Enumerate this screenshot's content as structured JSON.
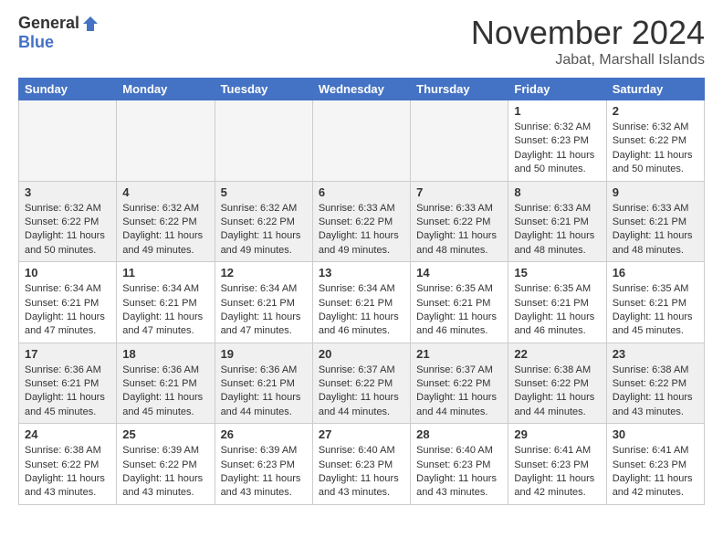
{
  "logo": {
    "general": "General",
    "blue": "Blue"
  },
  "header": {
    "month": "November 2024",
    "location": "Jabat, Marshall Islands"
  },
  "weekdays": [
    "Sunday",
    "Monday",
    "Tuesday",
    "Wednesday",
    "Thursday",
    "Friday",
    "Saturday"
  ],
  "weeks": [
    [
      {
        "day": "",
        "info": ""
      },
      {
        "day": "",
        "info": ""
      },
      {
        "day": "",
        "info": ""
      },
      {
        "day": "",
        "info": ""
      },
      {
        "day": "",
        "info": ""
      },
      {
        "day": "1",
        "info": "Sunrise: 6:32 AM\nSunset: 6:23 PM\nDaylight: 11 hours\nand 50 minutes."
      },
      {
        "day": "2",
        "info": "Sunrise: 6:32 AM\nSunset: 6:22 PM\nDaylight: 11 hours\nand 50 minutes."
      }
    ],
    [
      {
        "day": "3",
        "info": "Sunrise: 6:32 AM\nSunset: 6:22 PM\nDaylight: 11 hours\nand 50 minutes."
      },
      {
        "day": "4",
        "info": "Sunrise: 6:32 AM\nSunset: 6:22 PM\nDaylight: 11 hours\nand 49 minutes."
      },
      {
        "day": "5",
        "info": "Sunrise: 6:32 AM\nSunset: 6:22 PM\nDaylight: 11 hours\nand 49 minutes."
      },
      {
        "day": "6",
        "info": "Sunrise: 6:33 AM\nSunset: 6:22 PM\nDaylight: 11 hours\nand 49 minutes."
      },
      {
        "day": "7",
        "info": "Sunrise: 6:33 AM\nSunset: 6:22 PM\nDaylight: 11 hours\nand 48 minutes."
      },
      {
        "day": "8",
        "info": "Sunrise: 6:33 AM\nSunset: 6:21 PM\nDaylight: 11 hours\nand 48 minutes."
      },
      {
        "day": "9",
        "info": "Sunrise: 6:33 AM\nSunset: 6:21 PM\nDaylight: 11 hours\nand 48 minutes."
      }
    ],
    [
      {
        "day": "10",
        "info": "Sunrise: 6:34 AM\nSunset: 6:21 PM\nDaylight: 11 hours\nand 47 minutes."
      },
      {
        "day": "11",
        "info": "Sunrise: 6:34 AM\nSunset: 6:21 PM\nDaylight: 11 hours\nand 47 minutes."
      },
      {
        "day": "12",
        "info": "Sunrise: 6:34 AM\nSunset: 6:21 PM\nDaylight: 11 hours\nand 47 minutes."
      },
      {
        "day": "13",
        "info": "Sunrise: 6:34 AM\nSunset: 6:21 PM\nDaylight: 11 hours\nand 46 minutes."
      },
      {
        "day": "14",
        "info": "Sunrise: 6:35 AM\nSunset: 6:21 PM\nDaylight: 11 hours\nand 46 minutes."
      },
      {
        "day": "15",
        "info": "Sunrise: 6:35 AM\nSunset: 6:21 PM\nDaylight: 11 hours\nand 46 minutes."
      },
      {
        "day": "16",
        "info": "Sunrise: 6:35 AM\nSunset: 6:21 PM\nDaylight: 11 hours\nand 45 minutes."
      }
    ],
    [
      {
        "day": "17",
        "info": "Sunrise: 6:36 AM\nSunset: 6:21 PM\nDaylight: 11 hours\nand 45 minutes."
      },
      {
        "day": "18",
        "info": "Sunrise: 6:36 AM\nSunset: 6:21 PM\nDaylight: 11 hours\nand 45 minutes."
      },
      {
        "day": "19",
        "info": "Sunrise: 6:36 AM\nSunset: 6:21 PM\nDaylight: 11 hours\nand 44 minutes."
      },
      {
        "day": "20",
        "info": "Sunrise: 6:37 AM\nSunset: 6:22 PM\nDaylight: 11 hours\nand 44 minutes."
      },
      {
        "day": "21",
        "info": "Sunrise: 6:37 AM\nSunset: 6:22 PM\nDaylight: 11 hours\nand 44 minutes."
      },
      {
        "day": "22",
        "info": "Sunrise: 6:38 AM\nSunset: 6:22 PM\nDaylight: 11 hours\nand 44 minutes."
      },
      {
        "day": "23",
        "info": "Sunrise: 6:38 AM\nSunset: 6:22 PM\nDaylight: 11 hours\nand 43 minutes."
      }
    ],
    [
      {
        "day": "24",
        "info": "Sunrise: 6:38 AM\nSunset: 6:22 PM\nDaylight: 11 hours\nand 43 minutes."
      },
      {
        "day": "25",
        "info": "Sunrise: 6:39 AM\nSunset: 6:22 PM\nDaylight: 11 hours\nand 43 minutes."
      },
      {
        "day": "26",
        "info": "Sunrise: 6:39 AM\nSunset: 6:23 PM\nDaylight: 11 hours\nand 43 minutes."
      },
      {
        "day": "27",
        "info": "Sunrise: 6:40 AM\nSunset: 6:23 PM\nDaylight: 11 hours\nand 43 minutes."
      },
      {
        "day": "28",
        "info": "Sunrise: 6:40 AM\nSunset: 6:23 PM\nDaylight: 11 hours\nand 43 minutes."
      },
      {
        "day": "29",
        "info": "Sunrise: 6:41 AM\nSunset: 6:23 PM\nDaylight: 11 hours\nand 42 minutes."
      },
      {
        "day": "30",
        "info": "Sunrise: 6:41 AM\nSunset: 6:23 PM\nDaylight: 11 hours\nand 42 minutes."
      }
    ]
  ]
}
